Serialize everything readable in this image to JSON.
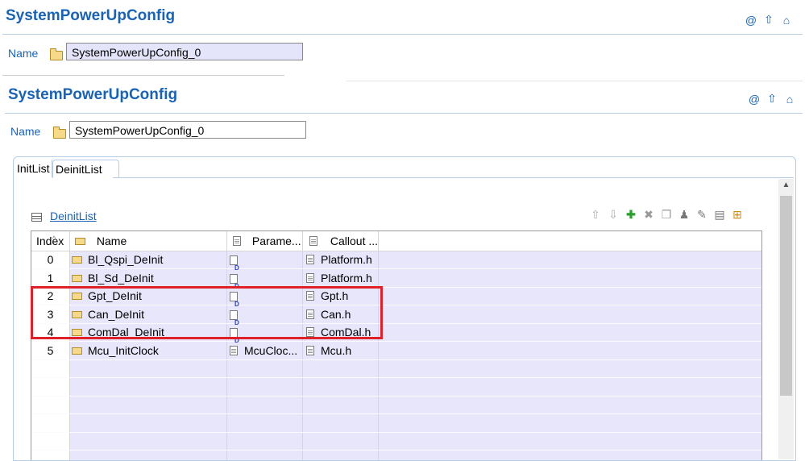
{
  "outer": {
    "title": "SystemPowerUpConfig",
    "name_label": "Name",
    "name_value": "SystemPowerUpConfig_0"
  },
  "inner": {
    "title": "SystemPowerUpConfig",
    "name_label": "Name",
    "name_value": "SystemPowerUpConfig_0"
  },
  "header_icons": [
    "at-icon",
    "up-arrow-icon",
    "home-icon"
  ],
  "tabs": [
    {
      "label": "InitList",
      "active": false
    },
    {
      "label": "DeinitList",
      "active": true
    }
  ],
  "section": {
    "label": "DeinitList"
  },
  "toolbar": [
    "move-up-icon",
    "move-down-icon",
    "add-icon",
    "delete-icon",
    "copy-icon",
    "user-icon",
    "edit-icon",
    "edit-table-icon",
    "import-icon"
  ],
  "table": {
    "headers": {
      "index": "Index",
      "name": "Name",
      "param": "Parame...",
      "callout": "Callout ..."
    },
    "rows": [
      {
        "index": "0",
        "name": "Bl_Qspi_DeInit",
        "param": "",
        "param_icon": "d-doc-icon",
        "callout": "Platform.h"
      },
      {
        "index": "1",
        "name": "Bl_Sd_DeInit",
        "param": "",
        "param_icon": "d-doc-icon",
        "callout": "Platform.h"
      },
      {
        "index": "2",
        "name": "Gpt_DeInit",
        "param": "",
        "param_icon": "d-doc-icon",
        "callout": "Gpt.h"
      },
      {
        "index": "3",
        "name": "Can_DeInit",
        "param": "",
        "param_icon": "d-doc-icon",
        "callout": "Can.h"
      },
      {
        "index": "4",
        "name": "ComDal_DeInit",
        "param": "",
        "param_icon": "d-doc-icon",
        "callout": "ComDal.h"
      },
      {
        "index": "5",
        "name": "Mcu_InitClock",
        "param": "McuCloc...",
        "param_icon": "doc-icon",
        "callout": "Mcu.h"
      }
    ]
  },
  "colors": {
    "accent": "#1a63b4",
    "row_bg": "#e7e6fb",
    "highlight": "#e0212a"
  }
}
